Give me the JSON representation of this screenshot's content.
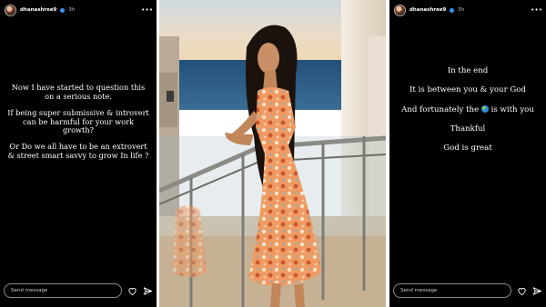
{
  "left_story": {
    "username": "dhanashree9",
    "time": "3h",
    "lines": [
      "Now I have started to question this on a serious note.",
      "If being super submissive & introvert can be harmful for your work growth?",
      "Or Do we all have to be an extrovert & street smart savvy to grow In life ?"
    ],
    "send_placeholder": "Send message"
  },
  "right_story": {
    "username": "dhanashree9",
    "time": "5h",
    "line1": "In the end",
    "line2": "It is between you & your God",
    "line3_a": "And fortunately the",
    "line3_b": "is with you",
    "line4": "Thankful",
    "line5": "God is great",
    "send_placeholder": "Send message"
  },
  "icons": {
    "verified": "verified-badge-icon",
    "more": "more-dots-icon",
    "like": "heart-icon",
    "share": "send-arrow-icon",
    "emoji": "globe-emoji-icon"
  },
  "colors": {
    "story_bg": "#000000",
    "text": "#ffffff",
    "verified": "#3897f0",
    "sky": "#e9d9c2",
    "sea": "#2c5c86",
    "dress": "#e68a55"
  }
}
